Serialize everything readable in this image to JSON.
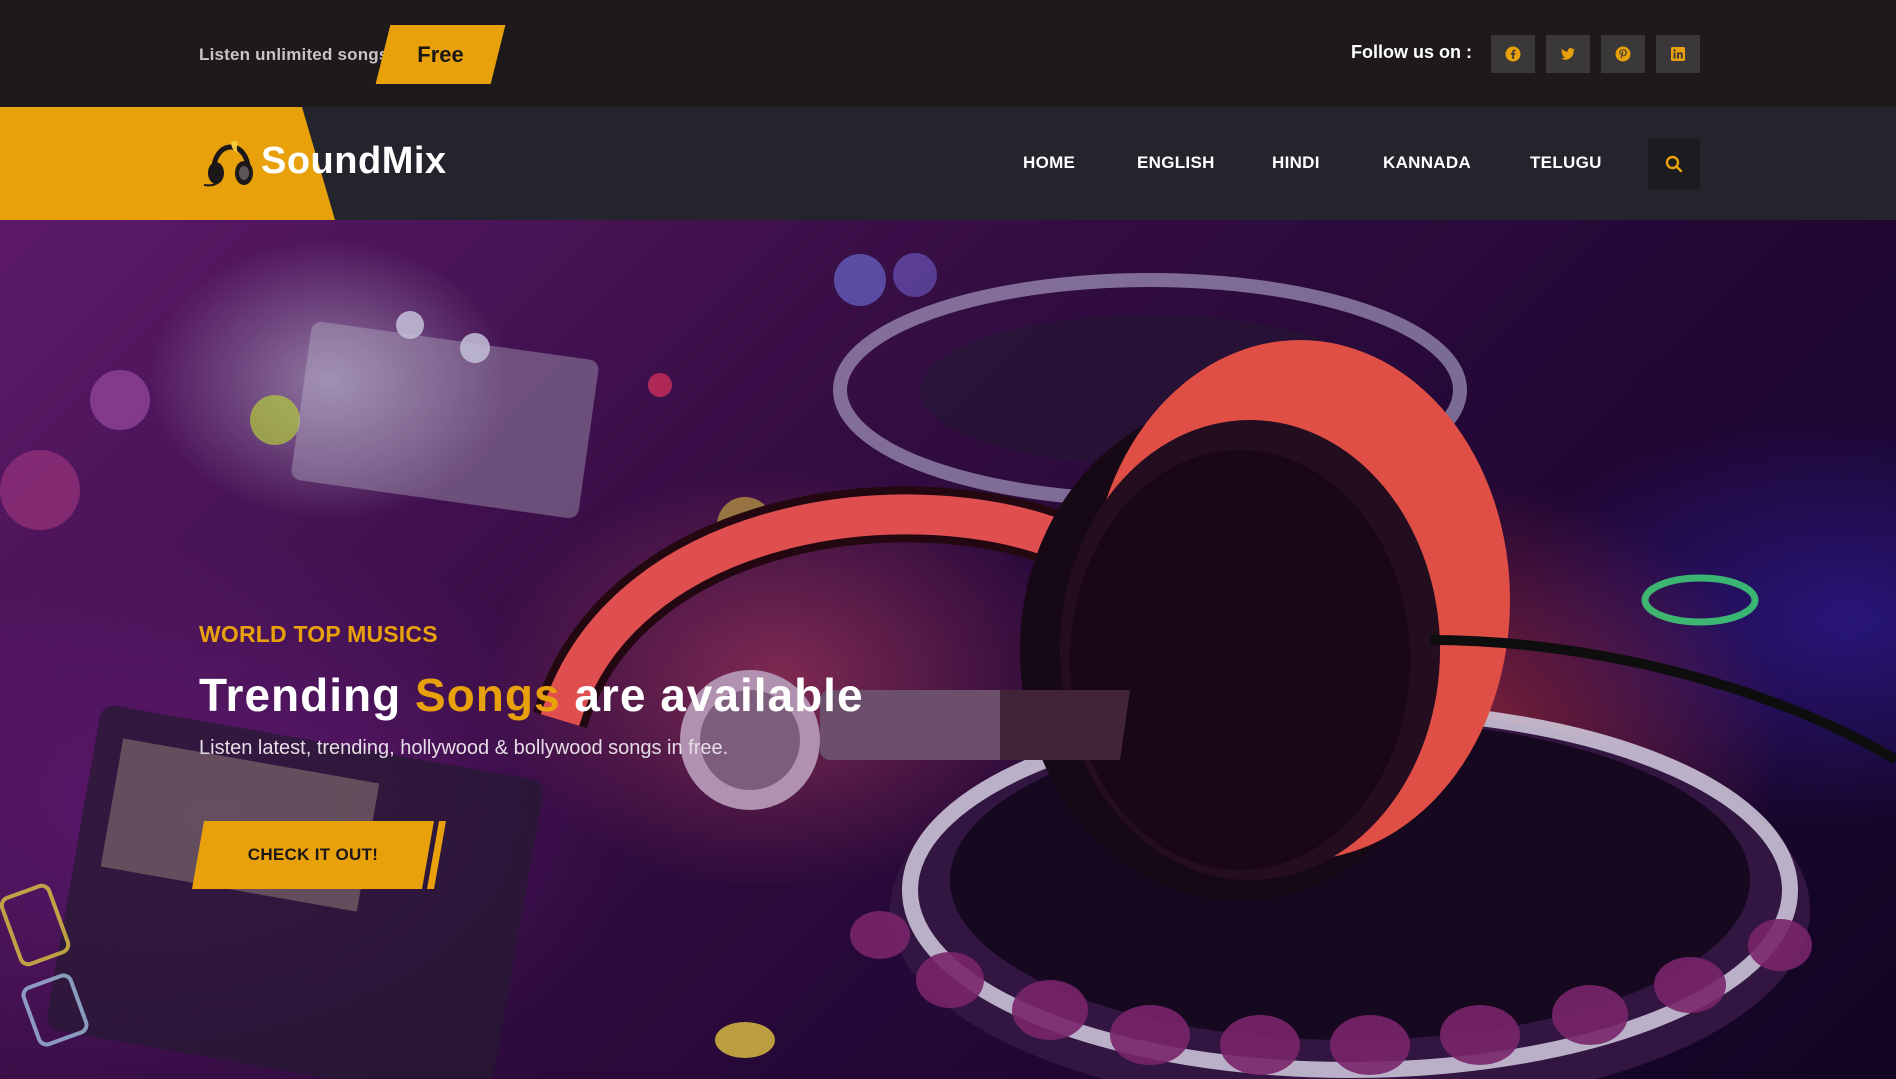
{
  "topbar": {
    "promo_text": "Listen unlimited songs",
    "badge": "Free",
    "follow_label": "Follow us on :",
    "social": [
      {
        "name": "facebook",
        "icon": "facebook-icon"
      },
      {
        "name": "twitter",
        "icon": "twitter-icon"
      },
      {
        "name": "pinterest",
        "icon": "pinterest-icon"
      },
      {
        "name": "linkedin",
        "icon": "linkedin-icon"
      }
    ]
  },
  "nav": {
    "logo_text": "SoundMix",
    "items": [
      "HOME",
      "ENGLISH",
      "HINDI",
      "KANNADA",
      "TELUGU"
    ],
    "search_icon": "search-icon"
  },
  "hero": {
    "kicker": "WORLD TOP MUSICS",
    "title_part1": "Trending ",
    "title_highlight": "Songs",
    "title_part2": " are available",
    "subtitle": "Listen latest, trending, hollywood & bollywood songs in free.",
    "cta_label": "CHECK IT OUT!"
  },
  "colors": {
    "accent": "#e8a10a",
    "topbar_bg": "#1e1a1c",
    "navbar_bg": "#23242c"
  }
}
